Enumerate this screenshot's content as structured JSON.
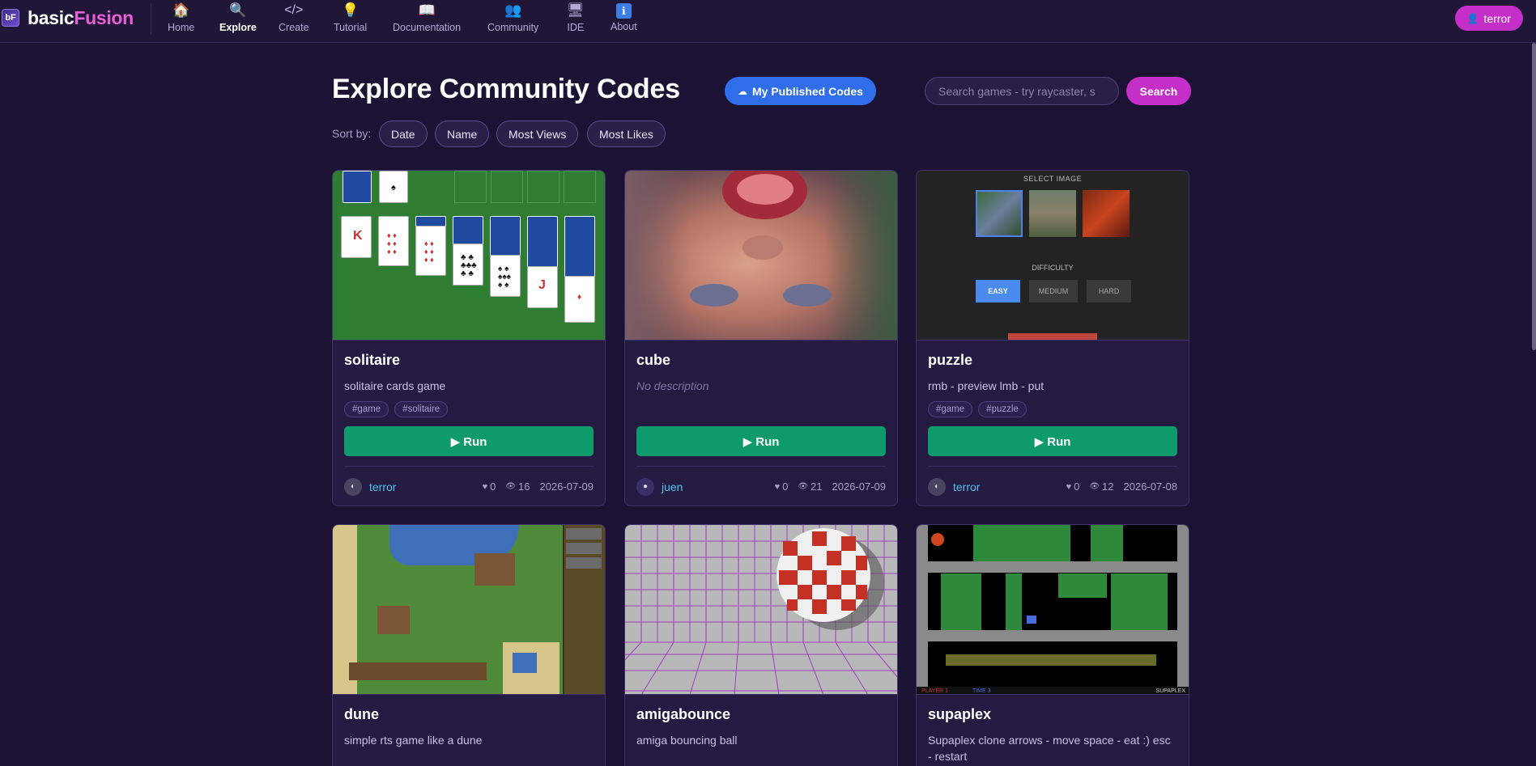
{
  "app": {
    "logo_main": "basic",
    "logo_accent": "Fusion",
    "logo_mark": "bF"
  },
  "nav": {
    "items": [
      {
        "label": "Home",
        "icon": "🏠"
      },
      {
        "label": "Explore",
        "icon": "🔍"
      },
      {
        "label": "Create",
        "icon": "</>"
      },
      {
        "label": "Tutorial",
        "icon": "💡"
      },
      {
        "label": "Documentation",
        "icon": "📖"
      },
      {
        "label": "Community",
        "icon": "👥"
      },
      {
        "label": "IDE",
        "icon": "🖥"
      },
      {
        "label": "About",
        "icon": "ℹ"
      }
    ],
    "active": "Explore",
    "user_label": "terror",
    "user_icon": "👤"
  },
  "header": {
    "title": "Explore Community Codes",
    "published_label": "My Published Codes",
    "published_icon": "☁",
    "search_placeholder": "Search games - try raycaster, s",
    "search_label": "Search"
  },
  "sort": {
    "label": "Sort by:",
    "options": [
      "Date",
      "Name",
      "Most Views",
      "Most Likes"
    ]
  },
  "cards": [
    {
      "title": "solitaire",
      "description": "solitaire cards game",
      "tags": [
        "#game",
        "#solitaire"
      ],
      "run_label": "▶ Run",
      "author": "terror",
      "likes": "0",
      "views": "16",
      "date": "2026-07-09"
    },
    {
      "title": "cube",
      "description": "No description",
      "tags": [],
      "run_label": "▶ Run",
      "author": "juen",
      "likes": "0",
      "views": "21",
      "date": "2026-07-09"
    },
    {
      "title": "puzzle",
      "description": "rmb - preview lmb - put",
      "tags": [
        "#game",
        "#puzzle"
      ],
      "run_label": "▶ Run",
      "author": "terror",
      "likes": "0",
      "views": "12",
      "date": "2026-07-08"
    },
    {
      "title": "dune",
      "description": "simple rts game like a dune"
    },
    {
      "title": "amigabounce",
      "description": "amiga bouncing ball"
    },
    {
      "title": "supaplex",
      "description": "Supaplex clone arrows - move space - eat :) esc - restart"
    }
  ],
  "thumb_text": {
    "puzzle_select": "SELECT IMAGE",
    "puzzle_difficulty": "DIFFICULTY",
    "puzzle_easy": "EASY",
    "puzzle_medium": "MEDIUM",
    "puzzle_hard": "HARD",
    "sup_player": "PLAYER 1",
    "sup_time": "TIME 3",
    "sup_name": "SUPAPLEX"
  },
  "icons": {
    "like": "♥",
    "view": "👁"
  }
}
